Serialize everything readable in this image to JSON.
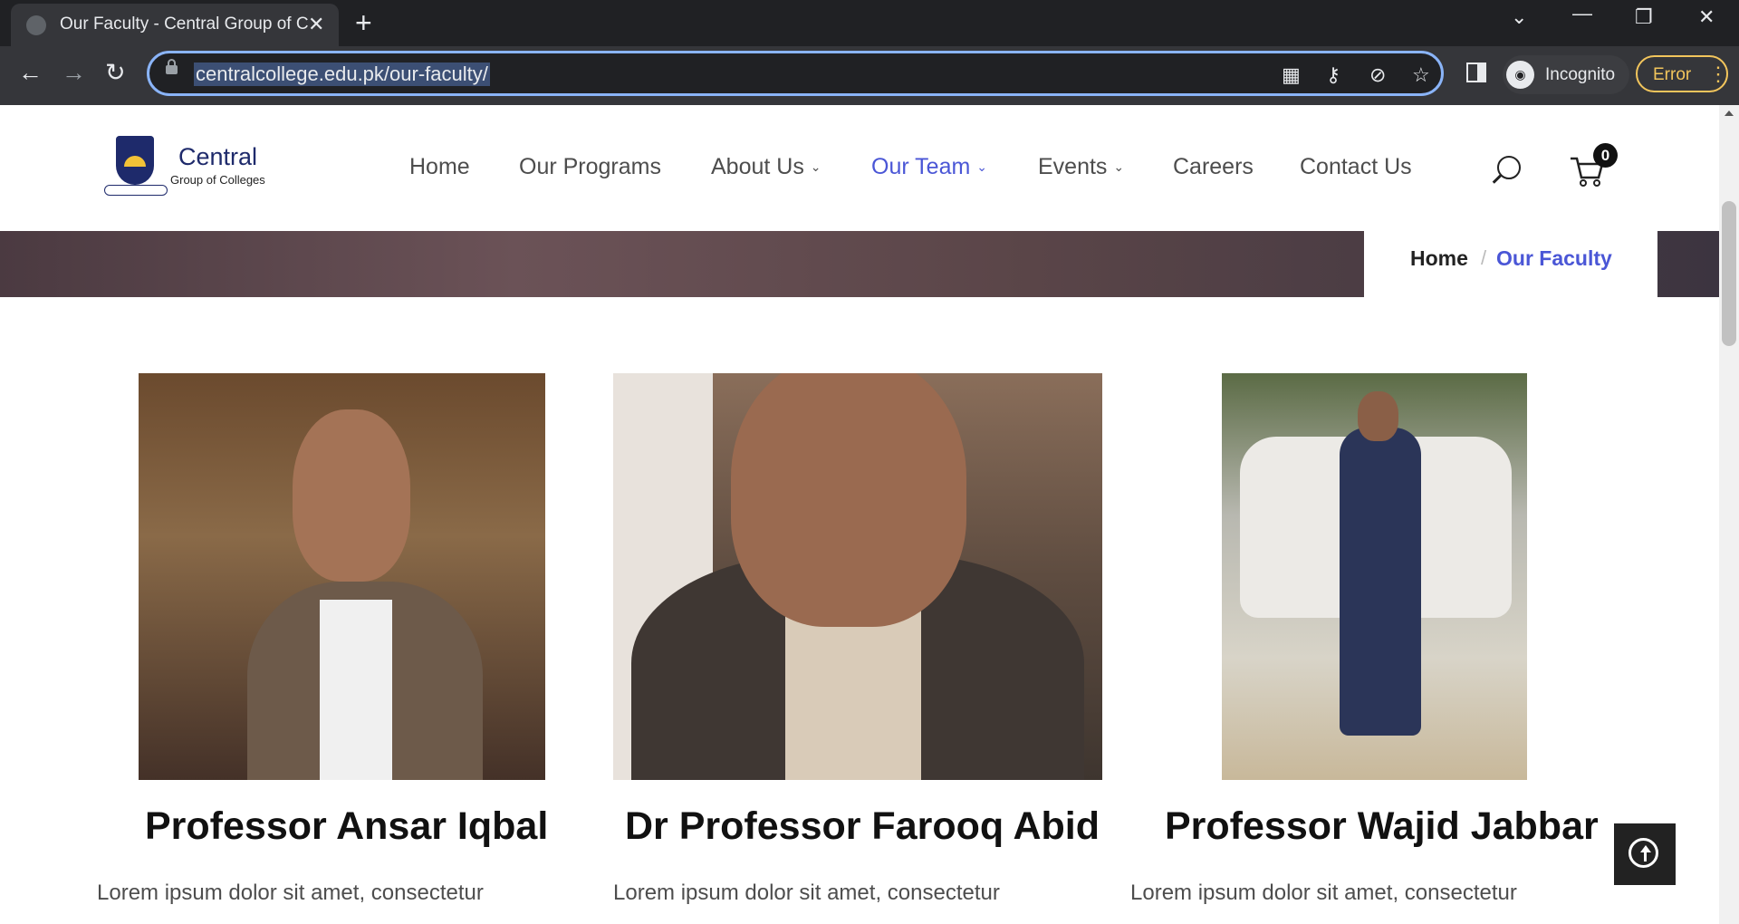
{
  "browser": {
    "tab_title": "Our Faculty - Central Group of Co",
    "new_tab": "+",
    "url": "centralcollege.edu.pk/our-faculty/",
    "incognito_label": "Incognito",
    "error_label": "Error"
  },
  "site": {
    "logo_name": "Central",
    "logo_sub": "Group of Colleges",
    "nav": [
      "Home",
      "Our Programs",
      "About Us",
      "Our Team",
      "Events",
      "Careers",
      "Contact Us"
    ],
    "active_nav": "Our Team",
    "cart_count": "0",
    "accent_color": "#4a56d6"
  },
  "breadcrumb": {
    "home": "Home",
    "separator": "/",
    "current": "Our Faculty"
  },
  "faculty": [
    {
      "name": "Professor Ansar Iqbal",
      "bio": "Lorem ipsum dolor sit amet, consectetur"
    },
    {
      "name": "Dr Professor Farooq Abid",
      "bio": "Lorem ipsum dolor sit amet, consectetur"
    },
    {
      "name": "Professor Wajid Jabbar",
      "bio": "Lorem ipsum dolor sit amet, consectetur"
    }
  ],
  "icons": [
    "search-icon",
    "cart-icon",
    "back-to-top-icon"
  ]
}
